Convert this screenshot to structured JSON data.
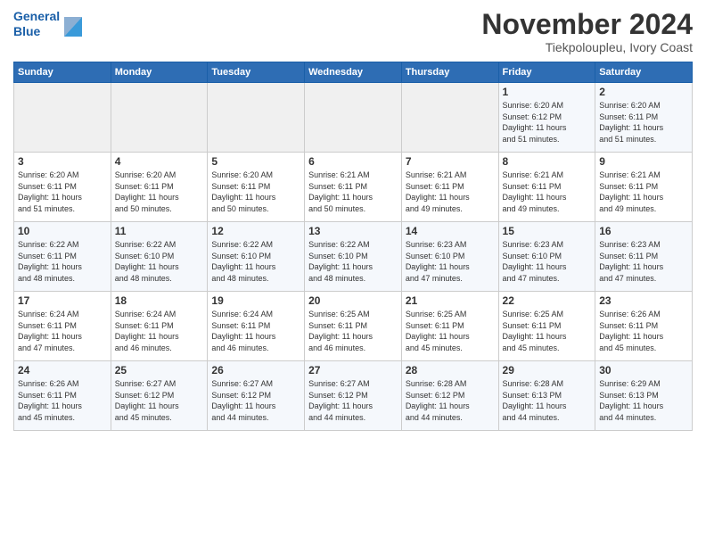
{
  "logo": {
    "line1": "General",
    "line2": "Blue"
  },
  "title": "November 2024",
  "location": "Tiekpoloupleu, Ivory Coast",
  "weekdays": [
    "Sunday",
    "Monday",
    "Tuesday",
    "Wednesday",
    "Thursday",
    "Friday",
    "Saturday"
  ],
  "weeks": [
    [
      {
        "day": "",
        "info": ""
      },
      {
        "day": "",
        "info": ""
      },
      {
        "day": "",
        "info": ""
      },
      {
        "day": "",
        "info": ""
      },
      {
        "day": "",
        "info": ""
      },
      {
        "day": "1",
        "info": "Sunrise: 6:20 AM\nSunset: 6:12 PM\nDaylight: 11 hours\nand 51 minutes."
      },
      {
        "day": "2",
        "info": "Sunrise: 6:20 AM\nSunset: 6:11 PM\nDaylight: 11 hours\nand 51 minutes."
      }
    ],
    [
      {
        "day": "3",
        "info": "Sunrise: 6:20 AM\nSunset: 6:11 PM\nDaylight: 11 hours\nand 51 minutes."
      },
      {
        "day": "4",
        "info": "Sunrise: 6:20 AM\nSunset: 6:11 PM\nDaylight: 11 hours\nand 50 minutes."
      },
      {
        "day": "5",
        "info": "Sunrise: 6:20 AM\nSunset: 6:11 PM\nDaylight: 11 hours\nand 50 minutes."
      },
      {
        "day": "6",
        "info": "Sunrise: 6:21 AM\nSunset: 6:11 PM\nDaylight: 11 hours\nand 50 minutes."
      },
      {
        "day": "7",
        "info": "Sunrise: 6:21 AM\nSunset: 6:11 PM\nDaylight: 11 hours\nand 49 minutes."
      },
      {
        "day": "8",
        "info": "Sunrise: 6:21 AM\nSunset: 6:11 PM\nDaylight: 11 hours\nand 49 minutes."
      },
      {
        "day": "9",
        "info": "Sunrise: 6:21 AM\nSunset: 6:11 PM\nDaylight: 11 hours\nand 49 minutes."
      }
    ],
    [
      {
        "day": "10",
        "info": "Sunrise: 6:22 AM\nSunset: 6:11 PM\nDaylight: 11 hours\nand 48 minutes."
      },
      {
        "day": "11",
        "info": "Sunrise: 6:22 AM\nSunset: 6:10 PM\nDaylight: 11 hours\nand 48 minutes."
      },
      {
        "day": "12",
        "info": "Sunrise: 6:22 AM\nSunset: 6:10 PM\nDaylight: 11 hours\nand 48 minutes."
      },
      {
        "day": "13",
        "info": "Sunrise: 6:22 AM\nSunset: 6:10 PM\nDaylight: 11 hours\nand 48 minutes."
      },
      {
        "day": "14",
        "info": "Sunrise: 6:23 AM\nSunset: 6:10 PM\nDaylight: 11 hours\nand 47 minutes."
      },
      {
        "day": "15",
        "info": "Sunrise: 6:23 AM\nSunset: 6:10 PM\nDaylight: 11 hours\nand 47 minutes."
      },
      {
        "day": "16",
        "info": "Sunrise: 6:23 AM\nSunset: 6:11 PM\nDaylight: 11 hours\nand 47 minutes."
      }
    ],
    [
      {
        "day": "17",
        "info": "Sunrise: 6:24 AM\nSunset: 6:11 PM\nDaylight: 11 hours\nand 47 minutes."
      },
      {
        "day": "18",
        "info": "Sunrise: 6:24 AM\nSunset: 6:11 PM\nDaylight: 11 hours\nand 46 minutes."
      },
      {
        "day": "19",
        "info": "Sunrise: 6:24 AM\nSunset: 6:11 PM\nDaylight: 11 hours\nand 46 minutes."
      },
      {
        "day": "20",
        "info": "Sunrise: 6:25 AM\nSunset: 6:11 PM\nDaylight: 11 hours\nand 46 minutes."
      },
      {
        "day": "21",
        "info": "Sunrise: 6:25 AM\nSunset: 6:11 PM\nDaylight: 11 hours\nand 45 minutes."
      },
      {
        "day": "22",
        "info": "Sunrise: 6:25 AM\nSunset: 6:11 PM\nDaylight: 11 hours\nand 45 minutes."
      },
      {
        "day": "23",
        "info": "Sunrise: 6:26 AM\nSunset: 6:11 PM\nDaylight: 11 hours\nand 45 minutes."
      }
    ],
    [
      {
        "day": "24",
        "info": "Sunrise: 6:26 AM\nSunset: 6:11 PM\nDaylight: 11 hours\nand 45 minutes."
      },
      {
        "day": "25",
        "info": "Sunrise: 6:27 AM\nSunset: 6:12 PM\nDaylight: 11 hours\nand 45 minutes."
      },
      {
        "day": "26",
        "info": "Sunrise: 6:27 AM\nSunset: 6:12 PM\nDaylight: 11 hours\nand 44 minutes."
      },
      {
        "day": "27",
        "info": "Sunrise: 6:27 AM\nSunset: 6:12 PM\nDaylight: 11 hours\nand 44 minutes."
      },
      {
        "day": "28",
        "info": "Sunrise: 6:28 AM\nSunset: 6:12 PM\nDaylight: 11 hours\nand 44 minutes."
      },
      {
        "day": "29",
        "info": "Sunrise: 6:28 AM\nSunset: 6:13 PM\nDaylight: 11 hours\nand 44 minutes."
      },
      {
        "day": "30",
        "info": "Sunrise: 6:29 AM\nSunset: 6:13 PM\nDaylight: 11 hours\nand 44 minutes."
      }
    ]
  ]
}
